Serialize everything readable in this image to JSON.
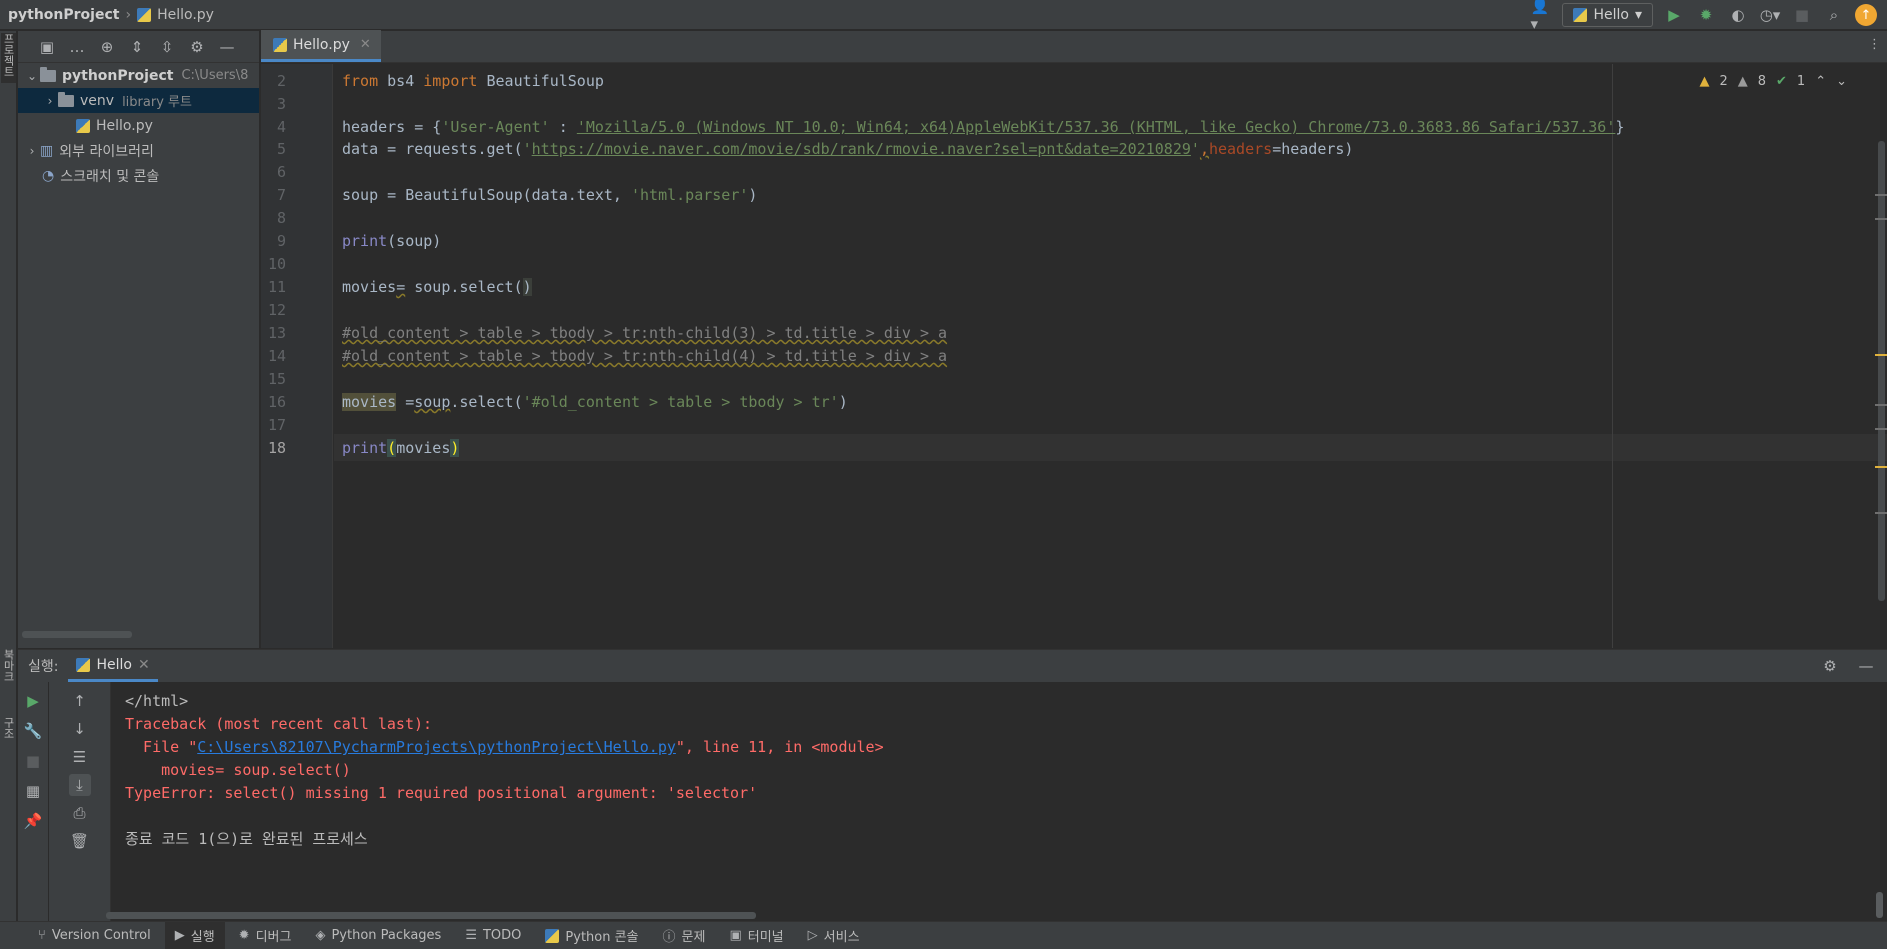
{
  "breadcrumb": {
    "project": "pythonProject",
    "file": "Hello.py"
  },
  "toolbar": {
    "run_config": "Hello"
  },
  "left_stripe": {
    "project_label": "프로젝트",
    "bookmarks_label": "북마크",
    "structure_label": "구조"
  },
  "project_tree": {
    "root": {
      "name": "pythonProject",
      "path": "C:\\Users\\8"
    },
    "venv": {
      "name": "venv",
      "tag": "library 루트"
    },
    "file": "Hello.py",
    "external": "외부 라이브러리",
    "scratches": "스크래치 및 콘솔"
  },
  "editor": {
    "tab": "Hello.py",
    "inspections": {
      "warnings": "2",
      "weak": "8",
      "ok": "1"
    },
    "line_numbers": [
      "2",
      "3",
      "4",
      "5",
      "6",
      "7",
      "8",
      "9",
      "10",
      "11",
      "12",
      "13",
      "14",
      "15",
      "16",
      "17",
      "18"
    ],
    "code": {
      "l2_kw1": "from",
      "l2_mod": " bs4 ",
      "l2_kw2": "import",
      "l2_name": " BeautifulSoup",
      "l4_a": "headers = {",
      "l4_key": "'User-Agent'",
      "l4_colon": " : ",
      "l4_val": "'Mozilla/5.0 (Windows NT 10.0; Win64; x64)AppleWebKit/537.36 (KHTML, like Gecko) Chrome/73.0.3683.86 Safari/537.36'",
      "l4_end": "}",
      "l5_a": "data = requests.get(",
      "l5_q1": "'",
      "l5_url": "https://movie.naver.com/movie/sdb/rank/rmovie.naver?sel=pnt&date=20210829",
      "l5_q2": "'",
      "l5_comma": ",",
      "l5_param": "headers",
      "l5_end": "=headers)",
      "l7_a": "soup = BeautifulSoup(data.text, ",
      "l7_str": "'html.parser'",
      "l7_end": ")",
      "l9_fn": "print",
      "l9_rest": "(soup)",
      "l11_a": "movies",
      "l11_eq": "=",
      "l11_b": " soup.select(",
      "l11_end": ")",
      "l13": "#old_content > table > tbody > tr:nth-child(3) > td.title > div > a",
      "l14": "#old_content > table > tbody > tr:nth-child(4) > td.title > div > a",
      "l16_var": "movies",
      "l16_a": " =",
      "l16_soup": "soup",
      "l16_b": ".select(",
      "l16_str": "'#old_content > table > tbody > tr'",
      "l16_end": ")",
      "l18_fn": "print",
      "l18_p1": "(",
      "l18_arg": "movies",
      "l18_p2": ")"
    }
  },
  "run": {
    "title": "실행:",
    "tab": "Hello",
    "console": {
      "l1": "</html>",
      "l2": "Traceback (most recent call last):",
      "l3_a": "  File \"",
      "l3_link": "C:\\Users\\82107\\PycharmProjects\\pythonProject\\Hello.py",
      "l3_b": "\", line 11, in <module>",
      "l4": "    movies= soup.select()",
      "l5": "TypeError: select() missing 1 required positional argument: 'selector'",
      "l7": "종료 코드 1(으)로 완료된 프로세스"
    }
  },
  "bottom_bar": [
    {
      "label": "Version Control",
      "icon": "branch-icon"
    },
    {
      "label": "실행",
      "icon": "play-icon"
    },
    {
      "label": "디버그",
      "icon": "bug-icon"
    },
    {
      "label": "Python Packages",
      "icon": "layers-icon"
    },
    {
      "label": "TODO",
      "icon": "list-icon"
    },
    {
      "label": "Python 콘솔",
      "icon": "python-icon"
    },
    {
      "label": "문제",
      "icon": "alert-icon"
    },
    {
      "label": "터미널",
      "icon": "terminal-icon"
    },
    {
      "label": "서비스",
      "icon": "services-icon"
    }
  ]
}
